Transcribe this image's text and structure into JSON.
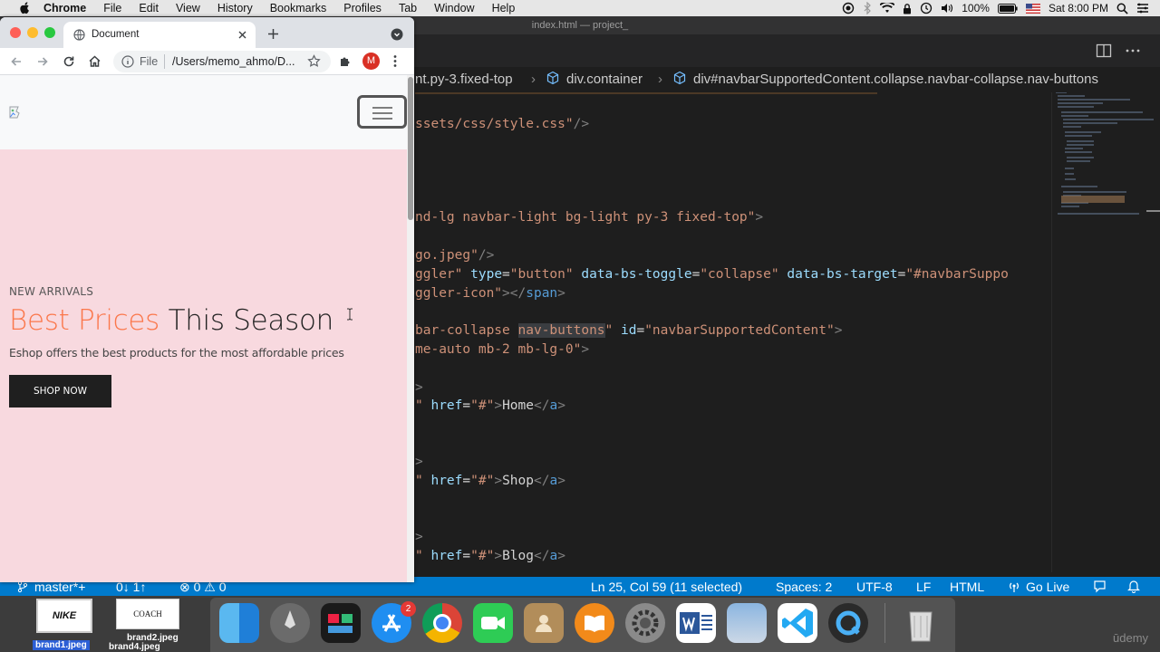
{
  "menubar": {
    "app": "Chrome",
    "items": [
      "File",
      "Edit",
      "View",
      "History",
      "Bookmarks",
      "Profiles",
      "Tab",
      "Window",
      "Help"
    ],
    "battery": "100%",
    "clock": "Sat 8:00 PM"
  },
  "vscode": {
    "window_title": "index.html — project_",
    "breadcrumb": {
      "part1": "nt.py-3.fixed-top",
      "part2": "div.container",
      "part3": "div#navbarSupportedContent.collapse.navbar-collapse.nav-buttons"
    },
    "code": {
      "l1_str": "ssets/css/style.css\"",
      "l1_end": "/>",
      "l2_str": "nd-lg navbar-light bg-light py-3 fixed-top\"",
      "l2_end": ">",
      "l3_str": "go.jpeg\"",
      "l3_end": "/>",
      "l4_a": "ggler\"",
      "l4_b": "type",
      "l4_c": "=",
      "l4_d": "\"button\"",
      "l4_e": "data-bs-toggle",
      "l4_f": "\"collapse\"",
      "l4_g": "data-bs-target",
      "l4_h": "\"#navbarSuppo",
      "l5_a": "ggler-icon\"",
      "l5_b": "></",
      "l5_c": "span",
      "l5_d": ">",
      "l6_a": "bar-collapse ",
      "l6_sel": "nav-buttons",
      "l6_b": "\"",
      "l6_c": "id",
      "l6_d": "\"navbarSupportedContent\"",
      "l6_e": ">",
      "l7_a": "me-auto mb-2 mb-lg-0\"",
      "l7_b": ">",
      "gt": ">",
      "q": "\"",
      "href": "href",
      "eq": "=",
      "hash": "\"#\"",
      "open": ">",
      "close_tag": "</",
      "a": "a",
      "home": "Home",
      "shop": "Shop",
      "blog": "Blog"
    },
    "status": {
      "branch": "master*+",
      "sync": "0↓ 1↑",
      "problems": "⊗ 0 ⚠ 0",
      "position": "Ln 25, Col 59 (11 selected)",
      "spaces": "Spaces: 2",
      "encoding": "UTF-8",
      "eol": "LF",
      "language": "HTML",
      "golive": "Go Live"
    }
  },
  "chrome": {
    "tab_title": "Document",
    "omnibox_scheme": "File",
    "omnibox_url": "/Users/memo_ahmo/D...",
    "profile_initial": "M",
    "page": {
      "kicker": "NEW ARRIVALS",
      "headline_accent": "Best Prices",
      "headline_rest": "This Season",
      "subtext": "Eshop offers the best products for the most affordable prices",
      "cta": "SHOP NOW"
    }
  },
  "desktop": {
    "files": [
      "brand1.jpeg",
      "brand2.jpeg",
      "brand4.jpeg"
    ],
    "thumb_nike": "NIKE",
    "thumb_coach": "COACH"
  },
  "dock": {
    "badge_appstore": "2",
    "watermark": "ūdemy"
  },
  "colors": {
    "accent": "#fb774b",
    "hero_bg": "#f8d9df",
    "vscode_status": "#007acc"
  }
}
